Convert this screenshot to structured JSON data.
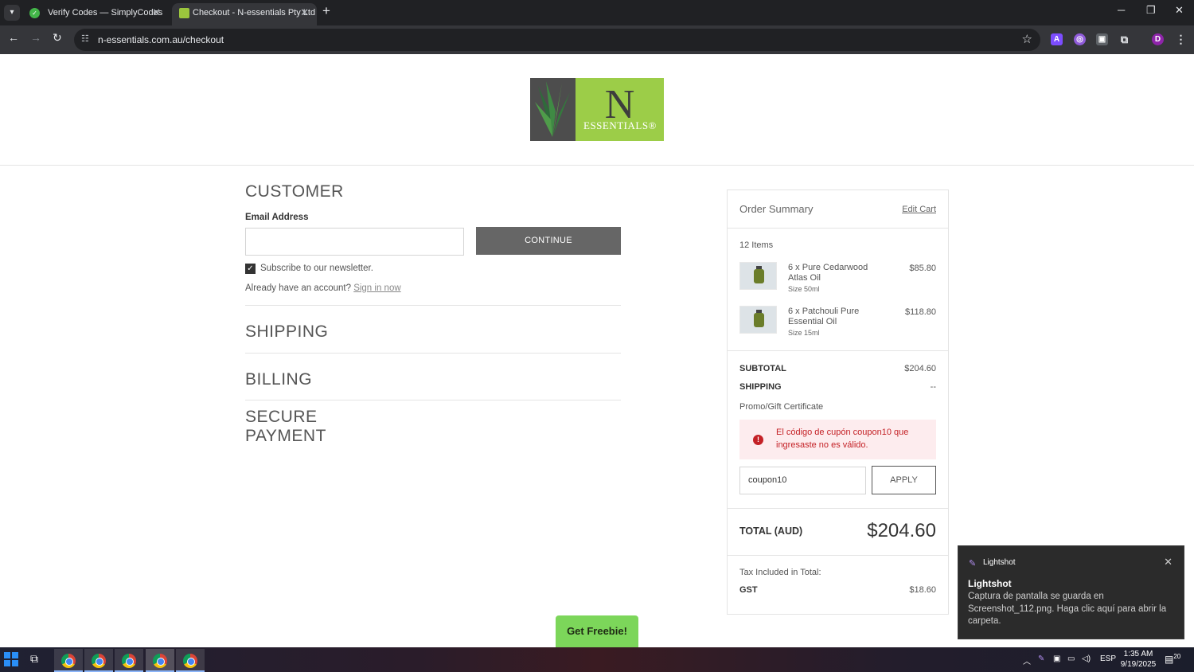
{
  "browser": {
    "tabs": [
      {
        "title": "Verify Codes — SimplyCodes",
        "active": false
      },
      {
        "title": "Checkout - N-essentials Pty Ltd",
        "active": true
      }
    ],
    "url": "n-essentials.com.au/checkout",
    "icons": {
      "tab_list": "chevron-down-icon",
      "new_tab": "+",
      "minimize": "─",
      "restore": "❐",
      "close": "✕",
      "back": "←",
      "forward": "→",
      "reload": "↻",
      "star": "☆",
      "menu": "⋮"
    }
  },
  "logo": {
    "letter": "N",
    "text": "ESSENTIALS®"
  },
  "checkout": {
    "customer_title": "CUSTOMER",
    "email_label": "Email Address",
    "email_value": "",
    "continue_label": "CONTINUE",
    "newsletter_label": "Subscribe to our newsletter.",
    "newsletter_checked": true,
    "account_prompt": "Already have an account?",
    "sign_in_label": "Sign in now",
    "shipping_title": "SHIPPING",
    "billing_title": "BILLING",
    "payment_title_line1": "SECURE",
    "payment_title_line2": "PAYMENT"
  },
  "summary": {
    "title": "Order Summary",
    "edit_cart": "Edit Cart",
    "item_count": "12 Items",
    "items": [
      {
        "name": "6 x Pure Cedarwood Atlas Oil",
        "size": "Size 50ml",
        "price": "$85.80"
      },
      {
        "name": "6 x Patchouli Pure Essential Oil",
        "size": "Size 15ml",
        "price": "$118.80"
      }
    ],
    "subtotal_label": "SUBTOTAL",
    "subtotal_value": "$204.60",
    "shipping_label": "SHIPPING",
    "shipping_value": "--",
    "promo_label": "Promo/Gift Certificate",
    "error_message": "El código de cupón coupon10 que ingresaste no es válido.",
    "coupon_value": "coupon10",
    "apply_label": "APPLY",
    "total_label": "TOTAL (AUD)",
    "total_value": "$204.60",
    "tax_label": "Tax Included in Total:",
    "gst_label": "GST",
    "gst_value": "$18.60"
  },
  "freebie_label": "Get Freebie!",
  "notification": {
    "app": "Lightshot",
    "title": "Lightshot",
    "body": "Captura de pantalla se guarda en Screenshot_112.png. Haga clic aquí para abrir la carpeta.",
    "close": "✕"
  },
  "taskbar": {
    "language": "ESP",
    "time": "1:35 AM",
    "date": "9/19/2025",
    "notification_count": "20"
  },
  "colors": {
    "logo_green": "#9ccd48",
    "continue_button": "#666666",
    "error_text": "#c42126",
    "error_bg": "#fdecee",
    "freebie_green": "#7cd65a"
  }
}
